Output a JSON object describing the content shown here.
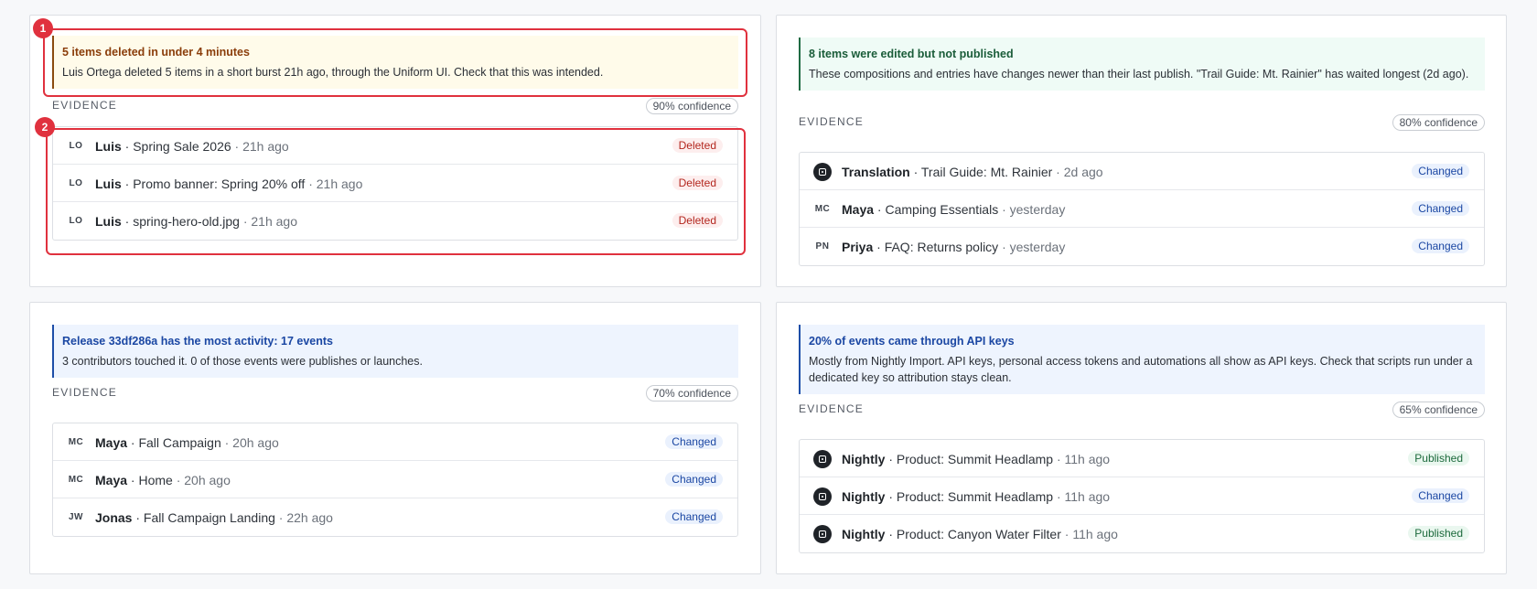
{
  "cards": [
    {
      "insight": {
        "title": "5 items deleted in under 4 minutes",
        "body": "Luis Ortega deleted 5 items in a short burst 21h ago, through the Uniform UI. Check that this was intended.",
        "tone": "warn"
      },
      "evidence_label": "EVIDENCE",
      "confidence": "90% confidence",
      "rows": [
        {
          "avatar": "LO",
          "who": "Luis",
          "item": " · Spring Sale 2026",
          "time": " · 21h ago",
          "badge": "Deleted"
        },
        {
          "avatar": "LO",
          "who": "Luis",
          "item": " · Promo banner: Spring 20% off",
          "time": " · 21h ago",
          "badge": "Deleted"
        },
        {
          "avatar": "LO",
          "who": "Luis",
          "item": " · spring-hero-old.jpg",
          "time": " · 21h ago",
          "badge": "Deleted"
        }
      ]
    },
    {
      "insight": {
        "title": "8 items were edited but not published",
        "body": "These compositions and entries have changes newer than their last publish. \"Trail Guide: Mt. Rainier\" has waited longest (2d ago).",
        "tone": "ok"
      },
      "evidence_label": "EVIDENCE",
      "confidence": "80% confidence",
      "rows": [
        {
          "avatar": "",
          "avatar_icon": "api-key-icon",
          "who": "Translation",
          "item": " · Trail Guide: Mt. Rainier",
          "time": " · 2d ago",
          "badge": "Changed"
        },
        {
          "avatar": "MC",
          "who": "Maya",
          "item": " · Camping Essentials",
          "time": " · yesterday",
          "badge": "Changed"
        },
        {
          "avatar": "PN",
          "who": "Priya",
          "item": " · FAQ: Returns policy",
          "time": " · yesterday",
          "badge": "Changed"
        }
      ]
    },
    {
      "insight": {
        "title": "Release 33df286a has the most activity: 17 events",
        "body": "3 contributors touched it. 0 of those events were publishes or launches.",
        "tone": "info"
      },
      "evidence_label": "EVIDENCE",
      "confidence": "70% confidence",
      "rows": [
        {
          "avatar": "MC",
          "who": "Maya",
          "item": " · Fall Campaign",
          "time": " · 20h ago",
          "badge": "Changed"
        },
        {
          "avatar": "MC",
          "who": "Maya",
          "item": " · Home",
          "time": " · 20h ago",
          "badge": "Changed"
        },
        {
          "avatar": "JW",
          "who": "Jonas",
          "item": " · Fall Campaign Landing",
          "time": " · 22h ago",
          "badge": "Changed"
        }
      ]
    },
    {
      "insight": {
        "title": "20% of events came through API keys",
        "body": "Mostly from Nightly Import. API keys, personal access tokens and automations all show as API keys. Check that scripts run under a dedicated key so attribution stays clean.",
        "tone": "info"
      },
      "evidence_label": "EVIDENCE",
      "confidence": "65% confidence",
      "rows": [
        {
          "avatar": "",
          "avatar_icon": "api-key-icon",
          "who": "Nightly",
          "item": " · Product: Summit Headlamp",
          "time": " · 11h ago",
          "badge": "Published"
        },
        {
          "avatar": "",
          "avatar_icon": "api-key-icon",
          "who": "Nightly",
          "item": " · Product: Summit Headlamp",
          "time": " · 11h ago",
          "badge": "Changed"
        },
        {
          "avatar": "",
          "avatar_icon": "api-key-icon",
          "who": "Nightly",
          "item": " · Product: Canyon Water Filter",
          "time": " · 11h ago",
          "badge": "Published"
        }
      ]
    }
  ],
  "annotations": {
    "marker_1": "1",
    "marker_2": "2"
  },
  "colors": {
    "highlight": "#e0313e",
    "warn": "#8a3d0a",
    "ok": "#1a5c39",
    "info": "#1b47a3"
  }
}
